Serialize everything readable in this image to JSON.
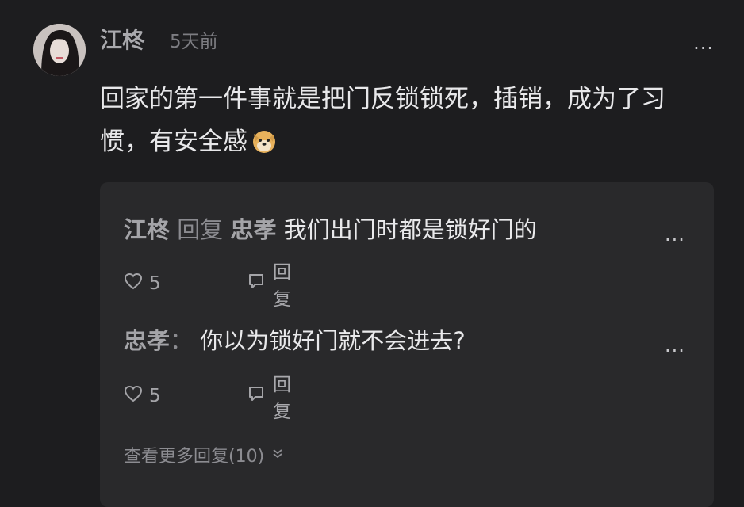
{
  "comment": {
    "author": "江柊",
    "time": "5天前",
    "more_label": "...",
    "text": "回家的第一件事就是把门反锁锁死，插销，成为了习惯，有安全感",
    "emoji_icon": "doge-emoji-icon"
  },
  "replies": [
    {
      "author": "江柊",
      "verb": "回复",
      "target": "忠孝",
      "text": "我们出门时都是锁好门的",
      "likes": "5",
      "reply_label": "回复",
      "more_label": "..."
    },
    {
      "author": "忠孝",
      "separator": "：",
      "text": "你以为锁好门就不会进去?",
      "likes": "5",
      "reply_label": "回复",
      "more_label": "..."
    }
  ],
  "view_more": {
    "label": "查看更多回复(10)",
    "icon": "chevron-down-icon"
  },
  "colors": {
    "background": "#1d1d1f",
    "card": "#29292b",
    "text": "#e8e8ea",
    "muted": "#8c8c91",
    "name": "#a4a4a8"
  }
}
